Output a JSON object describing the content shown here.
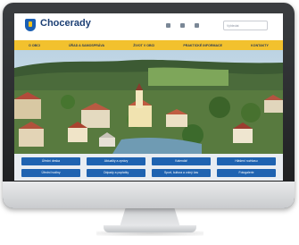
{
  "site": {
    "title": "Chocerady",
    "search_placeholder": "Vyhledat"
  },
  "nav": {
    "items": [
      {
        "label": "O OBCI"
      },
      {
        "label": "ÚŘAD A SAMOSPRÁVA"
      },
      {
        "label": "ŽIVOT V OBCI"
      },
      {
        "label": "PRAKTICKÉ INFORMACE"
      },
      {
        "label": "KONTAKTY"
      }
    ]
  },
  "tiles": {
    "row1": [
      "Úřední deska",
      "Aktuality a zprávy",
      "Kalendář",
      "Hlášení rozhlasu"
    ],
    "row2": [
      "Úřední hodiny",
      "Odpady a poplatky",
      "Sport, kultura a volný čas",
      "Fotogalerie"
    ]
  },
  "colors": {
    "nav_bg": "#f2c12e",
    "tile_bg": "#1f63b1",
    "title": "#1c3f74"
  }
}
